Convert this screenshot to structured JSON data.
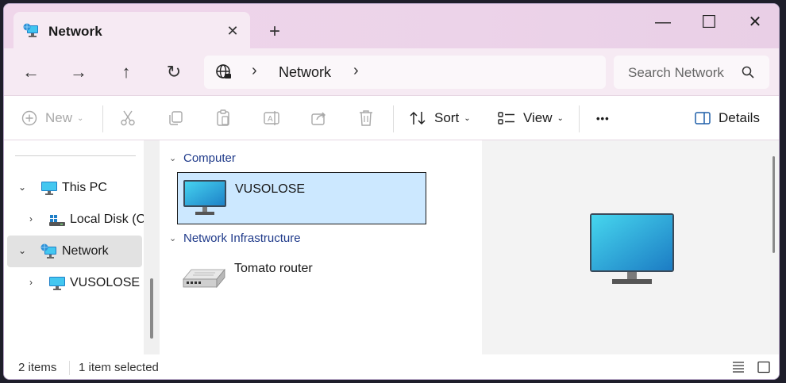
{
  "tab": {
    "title": "Network",
    "close_glyph": "✕",
    "new_tab_glyph": "+"
  },
  "window_controls": {
    "minimize": "—",
    "maximize": "☐",
    "close": "✕"
  },
  "nav": {
    "back_glyph": "←",
    "forward_glyph": "→",
    "up_glyph": "↑",
    "refresh_glyph": "↻",
    "breadcrumb": [
      "Network"
    ],
    "sep_glyph": "›",
    "search_placeholder": "Search Network"
  },
  "commands": {
    "new_label": "New",
    "sort_label": "Sort",
    "view_label": "View",
    "more_glyph": "•••",
    "details_label": "Details"
  },
  "sidebar": {
    "items": [
      {
        "label": "This PC",
        "icon": "pc-icon",
        "expanded": true
      },
      {
        "label": "Local Disk (C:)",
        "icon": "drive-icon",
        "expanded": false
      },
      {
        "label": "Network",
        "icon": "network-icon",
        "expanded": true,
        "selected": true
      },
      {
        "label": "VUSOLOSE",
        "icon": "monitor-icon",
        "expanded": false
      }
    ]
  },
  "content": {
    "groups": [
      {
        "title": "Computer",
        "items": [
          {
            "label": "VUSOLOSE",
            "icon": "monitor-icon",
            "selected": true
          }
        ]
      },
      {
        "title": "Network Infrastructure",
        "items": [
          {
            "label": "Tomato router",
            "icon": "router-icon",
            "selected": false
          }
        ]
      }
    ]
  },
  "status": {
    "count": "2 items",
    "selection": "1 item selected"
  },
  "colors": {
    "accent": "#1f3a8a",
    "selection": "#cce8ff",
    "titlebar": "#efd6ea"
  }
}
